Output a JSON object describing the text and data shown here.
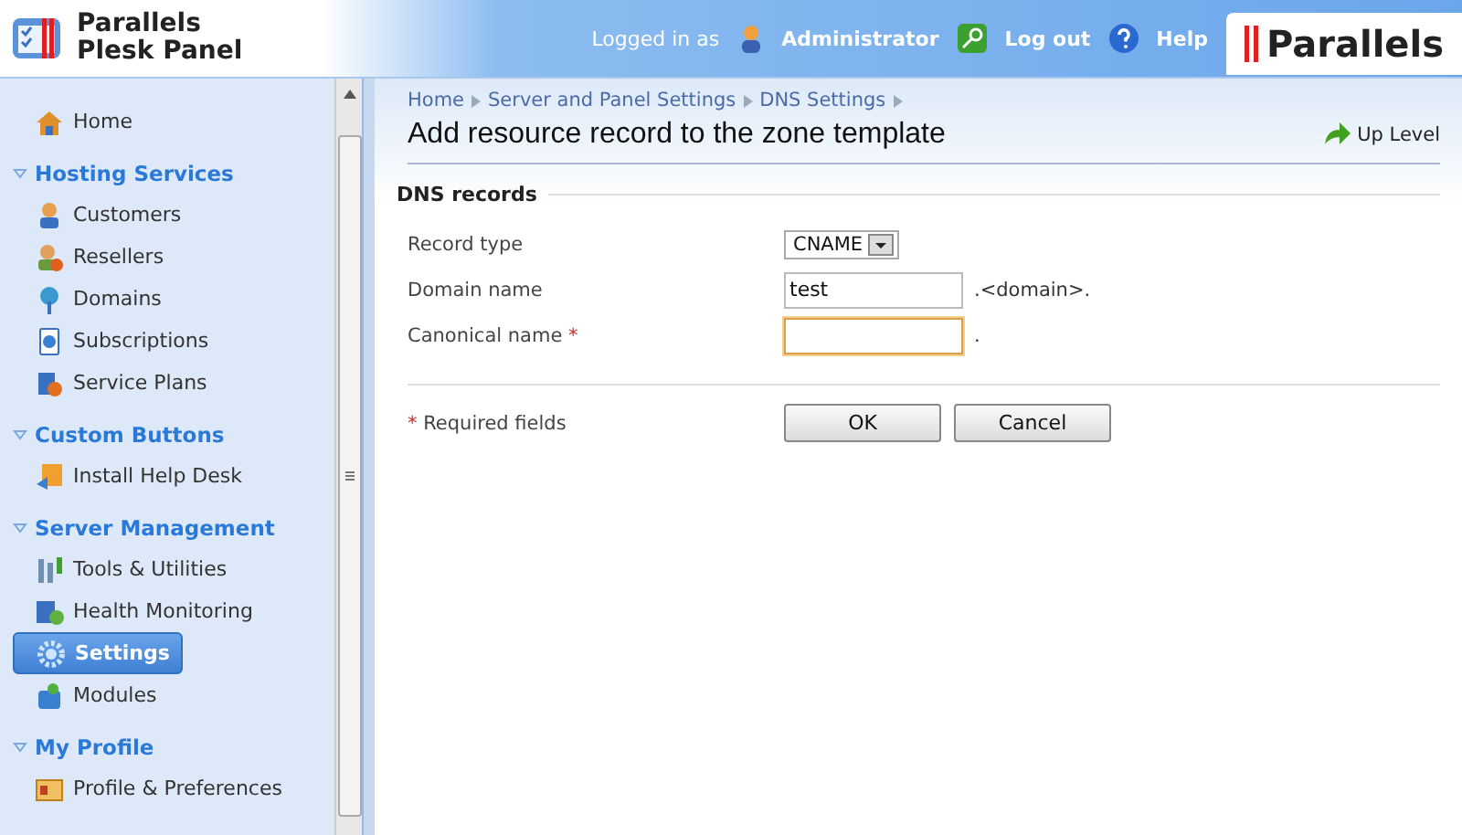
{
  "header": {
    "product_line1": "Parallels",
    "product_line2": "Plesk Panel",
    "logged_in_label": "Logged in as",
    "user": "Administrator",
    "logout": "Log out",
    "help": "Help",
    "brand": "Parallels"
  },
  "sidebar": {
    "home": {
      "label": "Home",
      "selected": false
    },
    "sections": [
      {
        "title": "Hosting Services",
        "expanded": true,
        "items": [
          {
            "label": "Customers",
            "selected": false
          },
          {
            "label": "Resellers",
            "selected": false
          },
          {
            "label": "Domains",
            "selected": false
          },
          {
            "label": "Subscriptions",
            "selected": false
          },
          {
            "label": "Service Plans",
            "selected": false
          }
        ]
      },
      {
        "title": "Custom Buttons",
        "expanded": true,
        "items": [
          {
            "label": "Install Help Desk",
            "selected": false
          }
        ]
      },
      {
        "title": "Server Management",
        "expanded": true,
        "items": [
          {
            "label": "Tools & Utilities",
            "selected": false
          },
          {
            "label": "Health Monitoring",
            "selected": false
          },
          {
            "label": "Settings",
            "selected": true
          },
          {
            "label": "Modules",
            "selected": false
          }
        ]
      },
      {
        "title": "My Profile",
        "expanded": true,
        "items": [
          {
            "label": "Profile & Preferences",
            "selected": false
          }
        ]
      }
    ]
  },
  "breadcrumbs": [
    "Home",
    "Server and Panel Settings",
    "DNS Settings"
  ],
  "page_title": "Add resource record to the zone template",
  "up_level": "Up Level",
  "form": {
    "section_title": "DNS records",
    "fields": [
      {
        "kind": "select",
        "label": "Record type",
        "required": false,
        "value": "CNAME"
      },
      {
        "kind": "text",
        "label": "Domain name",
        "required": false,
        "value": "test",
        "suffix": ".<domain>.",
        "focused": false
      },
      {
        "kind": "text",
        "label": "Canonical name",
        "required": true,
        "suffix": ".",
        "focused": true
      }
    ],
    "required_mark": "*",
    "required_note": "Required fields",
    "buttons": [
      "OK",
      "Cancel"
    ]
  }
}
